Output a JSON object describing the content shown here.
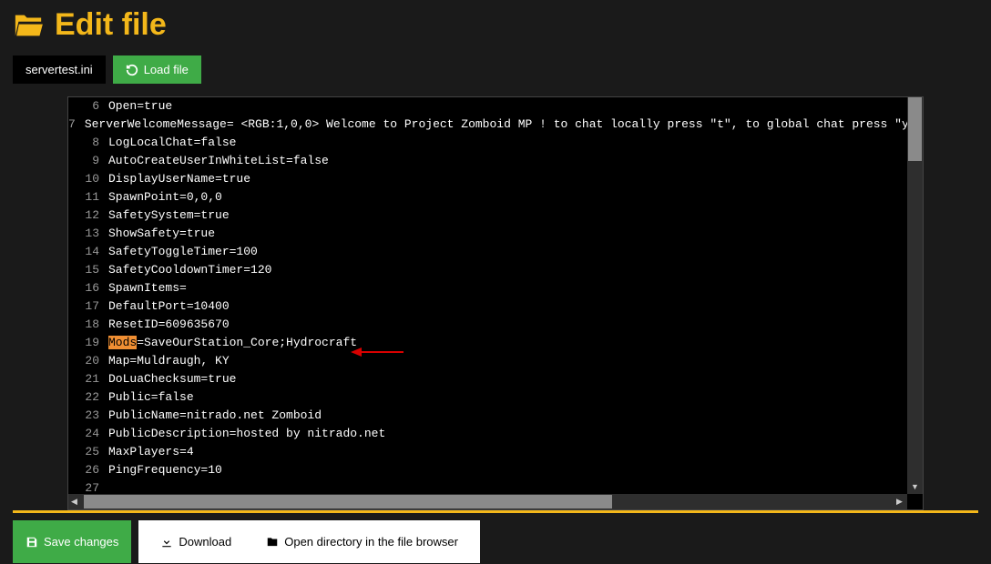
{
  "header": {
    "title": "Edit file"
  },
  "toolbar_top": {
    "file_name": "servertest.ini",
    "load_file": "Load file"
  },
  "editor": {
    "lines": [
      {
        "n": 6,
        "text": "Open=true"
      },
      {
        "n": 7,
        "text": "ServerWelcomeMessage= <RGB:1,0,0> Welcome to Project Zomboid MP ! to chat locally press \"t\", to global chat press \"y\" or add \"/all\""
      },
      {
        "n": 8,
        "text": "LogLocalChat=false"
      },
      {
        "n": 9,
        "text": "AutoCreateUserInWhiteList=false"
      },
      {
        "n": 10,
        "text": "DisplayUserName=true"
      },
      {
        "n": 11,
        "text": "SpawnPoint=0,0,0"
      },
      {
        "n": 12,
        "text": "SafetySystem=true"
      },
      {
        "n": 13,
        "text": "ShowSafety=true"
      },
      {
        "n": 14,
        "text": "SafetyToggleTimer=100"
      },
      {
        "n": 15,
        "text": "SafetyCooldownTimer=120"
      },
      {
        "n": 16,
        "text": "SpawnItems="
      },
      {
        "n": 17,
        "text": "DefaultPort=10400"
      },
      {
        "n": 18,
        "text": "ResetID=609635670"
      },
      {
        "n": 19,
        "highlight_key": "Mods",
        "text_after": "=SaveOurStation_Core;Hydrocraft"
      },
      {
        "n": 20,
        "text": "Map=Muldraugh, KY"
      },
      {
        "n": 21,
        "text": "DoLuaChecksum=true"
      },
      {
        "n": 22,
        "text": "Public=false"
      },
      {
        "n": 23,
        "text": "PublicName=nitrado.net Zomboid"
      },
      {
        "n": 24,
        "text": "PublicDescription=hosted by nitrado.net"
      },
      {
        "n": 25,
        "text": "MaxPlayers=4"
      },
      {
        "n": 26,
        "text": "PingFrequency=10"
      },
      {
        "n": 27,
        "text": ""
      }
    ]
  },
  "toolbar_bottom": {
    "save": "Save changes",
    "download": "Download",
    "open_dir": "Open directory in the file browser"
  }
}
